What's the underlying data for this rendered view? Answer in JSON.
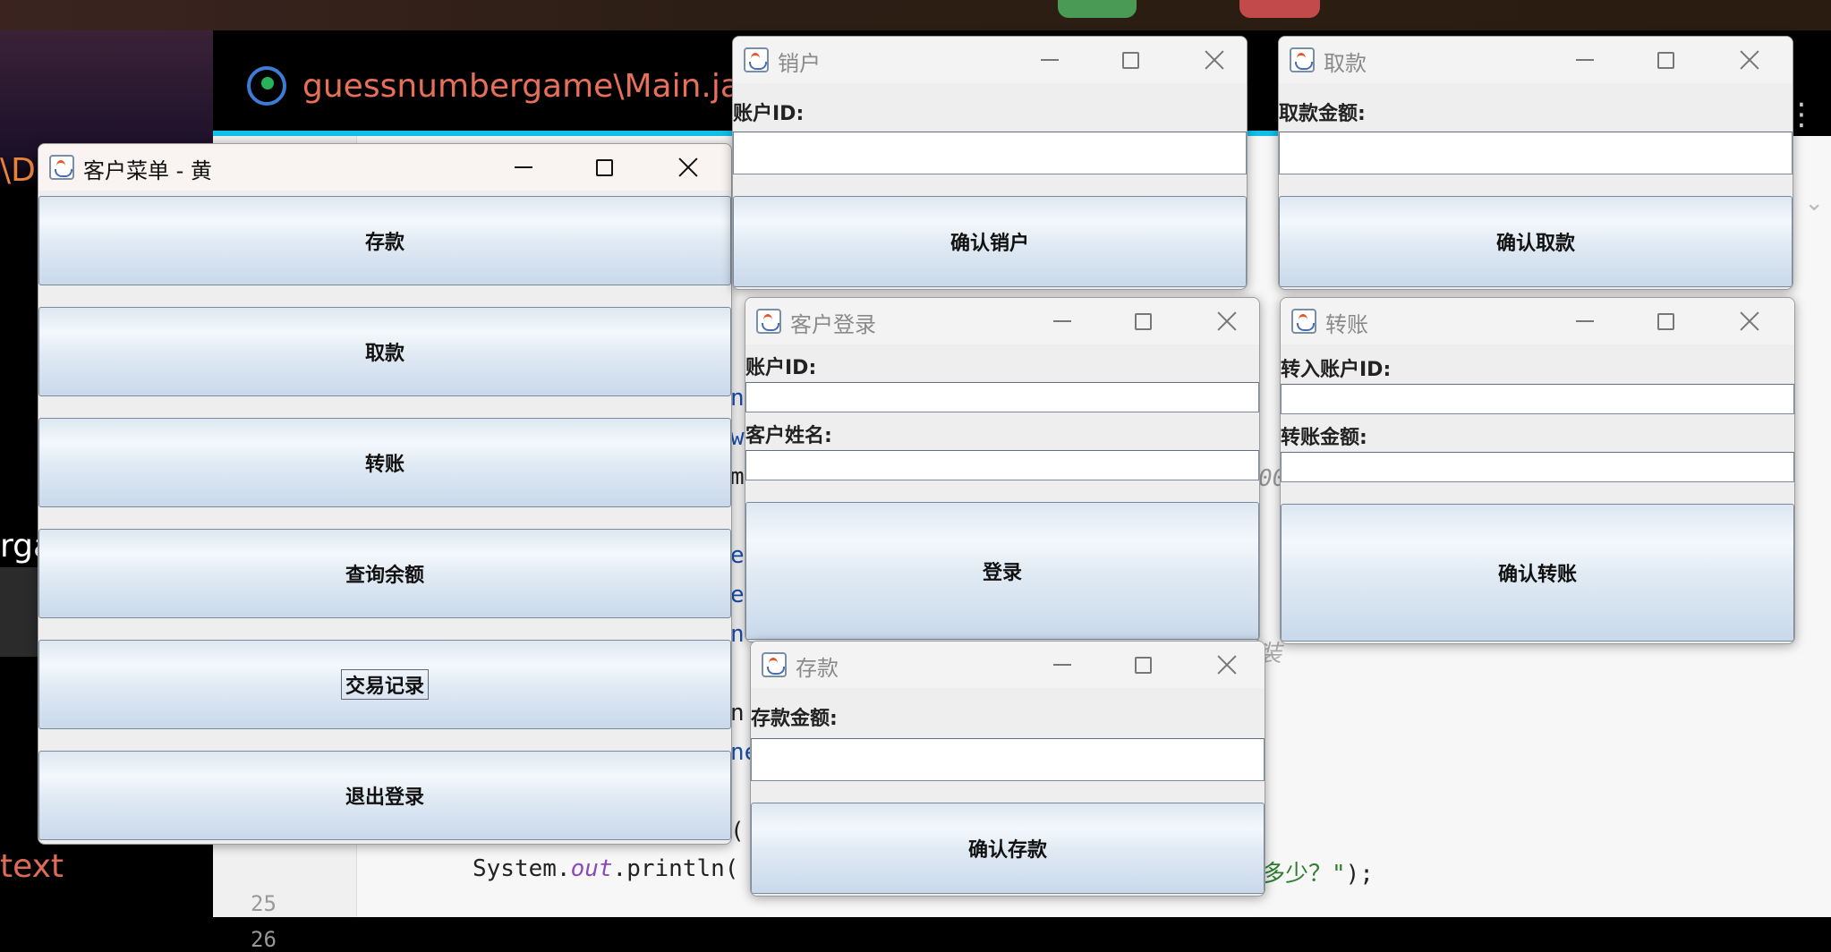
{
  "desktop": {
    "ide_tab_title": "guessnumbergame\\Main.jav",
    "left_fragment_top": "\\D",
    "left_fragment_mid": "rga",
    "left_fragment_bottom": "text",
    "line_numbers": [
      "25",
      "26"
    ],
    "code_prefix": "System.",
    "code_keyword": "out",
    "code_method": ".println(",
    "code_tail_string": "多少？\"",
    "code_tail_end": ");",
    "code_fragments": [
      "n",
      "w",
      "m",
      "e",
      "e",
      "ne",
      "n",
      "ne",
      "(",
      "00",
      "装"
    ],
    "more_icon": "more-vertical-icon",
    "chevron_icon": "chevron-down-icon"
  },
  "windows": {
    "customer_menu": {
      "title": "客户菜单 - 黄",
      "buttons": [
        "存款",
        "取款",
        "转账",
        "查询余额",
        "交易记录",
        "退出登录"
      ]
    },
    "close_account": {
      "title": "销户",
      "field_label": "账户ID:",
      "field_value": "",
      "confirm_button": "确认销户"
    },
    "withdraw": {
      "title": "取款",
      "field_label": "取款金额:",
      "field_value": "",
      "confirm_button": "确认取款"
    },
    "customer_login": {
      "title": "客户登录",
      "account_label": "账户ID:",
      "account_value": "",
      "name_label": "客户姓名:",
      "name_value": "",
      "login_button": "登录"
    },
    "transfer": {
      "title": "转账",
      "target_label": "转入账户ID:",
      "target_value": "",
      "amount_label": "转账金额:",
      "amount_value": "",
      "confirm_button": "确认转账"
    },
    "deposit": {
      "title": "存款",
      "field_label": "存款金额:",
      "field_value": "",
      "confirm_button": "确认存款"
    }
  },
  "colors": {
    "ide_tab_title": "#e86f5a",
    "tab_underline": "#11c0e8",
    "left_text": "#e8833a",
    "button_gradient_top": "#dde7f1",
    "button_gradient_bottom": "#c9d9ea"
  }
}
